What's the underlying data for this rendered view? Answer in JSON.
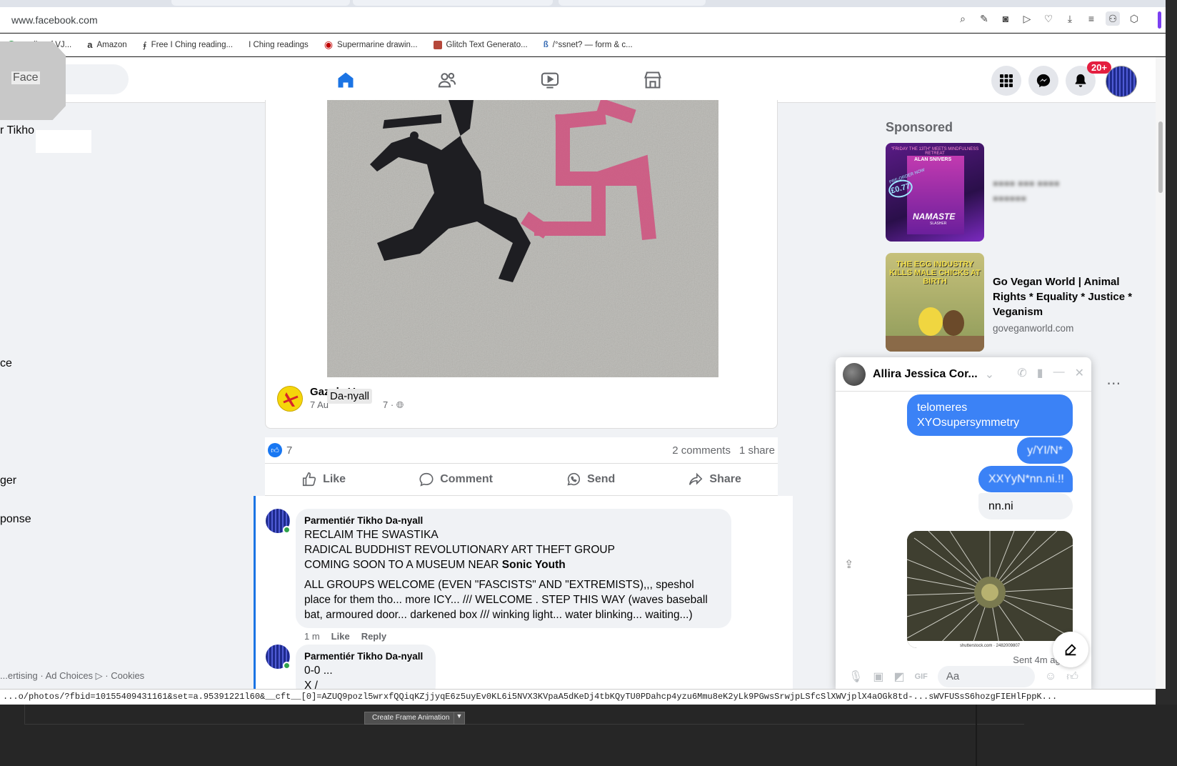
{
  "browser": {
    "url": "www.facebook.com",
    "bookmarks": [
      {
        "label": "...e list of VJ...",
        "color": "#34a853"
      },
      {
        "label": "Amazon",
        "color": "#111111"
      },
      {
        "label": "Free I Ching reading...",
        "color": "#444444"
      },
      {
        "label": "I Ching readings",
        "color": "#ffffff"
      },
      {
        "label": "Supermarine drawin...",
        "color": "#c00000"
      },
      {
        "label": "Glitch Text Generato...",
        "color": "#b5473a"
      },
      {
        "label": "/°ssnet? — form & c...",
        "color": "#3b6fb6"
      }
    ],
    "status_url": "...o/photos/?fbid=10155409431161&set=a.95391221l60&__cft__[0]=AZUQ9pozl5wrxfQQiqKZjjyqE6z5uyEv0KL6i5NVX3KVpaA5dKeDj4tbKQyTU0PDahcp4yzu6Mmu8eK2yLk9PGwsSrwjpLSfcSlXWVjplX4aOGk8td-...sWVFUSsS6hozgFIEHlFppK..."
  },
  "header": {
    "logo_text": "Face",
    "notif_count": "20+"
  },
  "left": {
    "fragments": [
      "r Tikho",
      "ce",
      "ger",
      "ponse"
    ],
    "footer": "...ertising · Ad Choices ▷ · Cookies"
  },
  "post": {
    "author_name": "Gaz de Vere",
    "author_meta": "7 Au",
    "author_meta_tail": "7 ·",
    "tooltip": "Da-nyall",
    "likes": "7",
    "comments_count": "2 comments",
    "shares_count": "1 share",
    "actions": {
      "like": "Like",
      "comment": "Comment",
      "send": "Send",
      "share": "Share"
    }
  },
  "comments": [
    {
      "name": "Parmentiér Tikho Da-nyall",
      "line1": "RECLAIM THE SWASTIKA",
      "line2": "RADICAL BUDDHIST REVOLUTIONARY ART THEFT GROUP",
      "line3": "COMING SOON TO A MUSEUM NEAR",
      "line3_bold": "Sonic Youth",
      "para": "ALL GROUPS WELCOME (EVEN \"FASCISTS\" AND \"EXTREMISTS),,, speshol place for them tho... more ICY... /// WELCOME . STEP THIS WAY (waves baseball bat, armoured door... darkened box /// winking light... water blinking... waiting...)",
      "time": "1 m",
      "like": "Like",
      "reply": "Reply"
    },
    {
      "name": "Parmentiér Tikho Da-nyall",
      "line1": "0-0 ...",
      "line2": "X /"
    }
  ],
  "sponsored": {
    "title": "Sponsored",
    "ad1": {
      "img_headline": "\"FRIDAY THE 13TH\" MEETS MINDFULNESS RETREAT",
      "img_author": "ALAN SNIVERS",
      "img_title": "NAMASTE",
      "img_sub": "SLASHER",
      "img_badge": "£0.77",
      "img_preorder": "PRE-ORDER NOW",
      "text": "■■■■ ■■■ ■■■■",
      "sub": "■■■■■■"
    },
    "ad2": {
      "img_caption": "THE EGG INDUSTRY KILLS MALE CHICKS AT BIRTH",
      "text": "Go Vegan World | Animal Rights * Equality * Justice * Veganism",
      "sub": "goveganworld.com"
    }
  },
  "chat": {
    "name": "Allira Jessica Cor...",
    "messages": [
      {
        "text1": "telomeres",
        "text2": "XYOsupersymmetry"
      },
      {
        "text": "y/YI/N*"
      },
      {
        "text": "XXYyN*nn.ni.!!"
      },
      {
        "text": "nn.ni"
      }
    ],
    "image_caption": "shutterstock.com · 2482009807",
    "sent": "Sent 4m ago",
    "input_placeholder": "Aa"
  },
  "app_bottom": {
    "button": "Create Frame Animation"
  },
  "colors": {
    "fb_blue": "#1b74e4",
    "messenger_blue": "#3b82f6",
    "badge_red": "#e41e3f",
    "online_green": "#31a24c"
  }
}
